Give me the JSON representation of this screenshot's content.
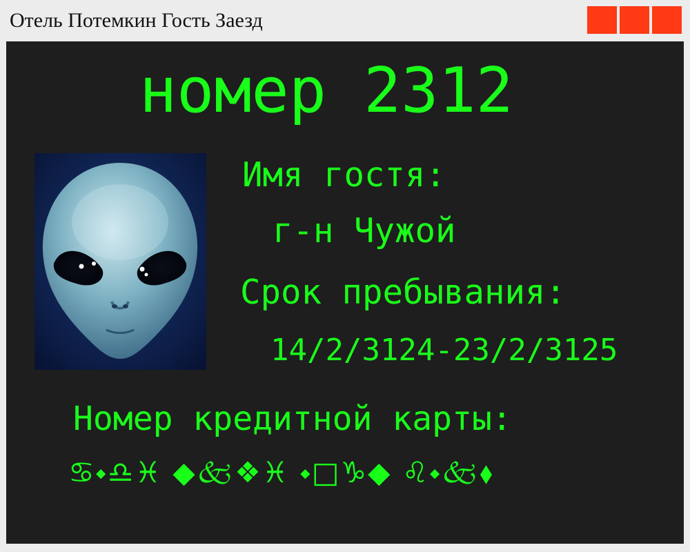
{
  "window": {
    "title": "Отель Потемкин Гость Заезд",
    "buttons": [
      "minimize",
      "maximize",
      "close"
    ],
    "button_color": "#ff3a14"
  },
  "screen": {
    "background": "#1e1e1e",
    "text_color": "#1aff1a",
    "room_title": "номер 2312",
    "guest_label": "Имя гостя:",
    "guest_name": "г-н Чужой",
    "stay_label": "Срок пребывания:",
    "stay_dates": "14/2/3124-23/2/3125",
    "cc_label": "Номер кредитной карты:",
    "cc_value": "♋⬩♎♓ ◆🙵❖♓ ⬩□♑◆ ♌⬩🙵⬧",
    "photo": "alien-face-photo"
  }
}
